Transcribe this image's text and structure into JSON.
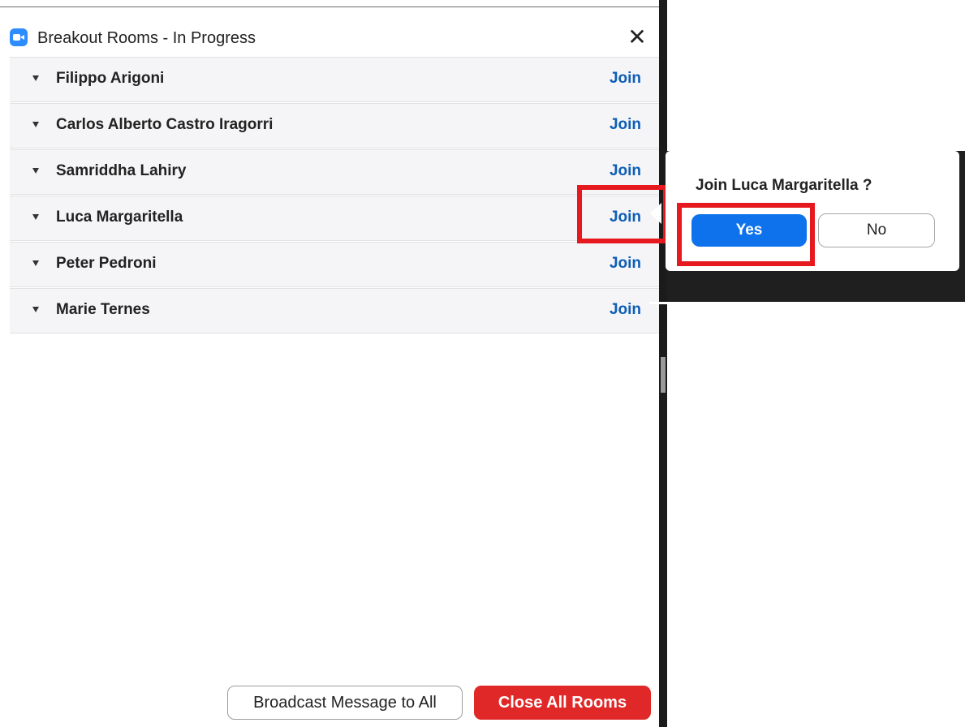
{
  "window": {
    "title": "Breakout Rooms - In Progress",
    "close_icon": "close-icon",
    "app_icon": "zoom-camera-icon",
    "accent": "#2d8cff"
  },
  "rooms": [
    {
      "name": "Filippo Arigoni",
      "action": "Join"
    },
    {
      "name": "Carlos Alberto Castro Iragorri",
      "action": "Join"
    },
    {
      "name": "Samriddha Lahiry",
      "action": "Join"
    },
    {
      "name": "Luca Margaritella",
      "action": "Join"
    },
    {
      "name": "Peter Pedroni",
      "action": "Join"
    },
    {
      "name": "Marie Ternes",
      "action": "Join"
    }
  ],
  "popover": {
    "question": "Join Luca Margaritella ?",
    "yes_label": "Yes",
    "no_label": "No"
  },
  "footer": {
    "broadcast_label": "Broadcast Message to All",
    "close_all_label": "Close All Rooms"
  },
  "colors": {
    "join_link": "#0e5db5",
    "primary_button": "#0e72ed",
    "danger_button": "#e02828",
    "annotation_box": "#e6191f"
  }
}
